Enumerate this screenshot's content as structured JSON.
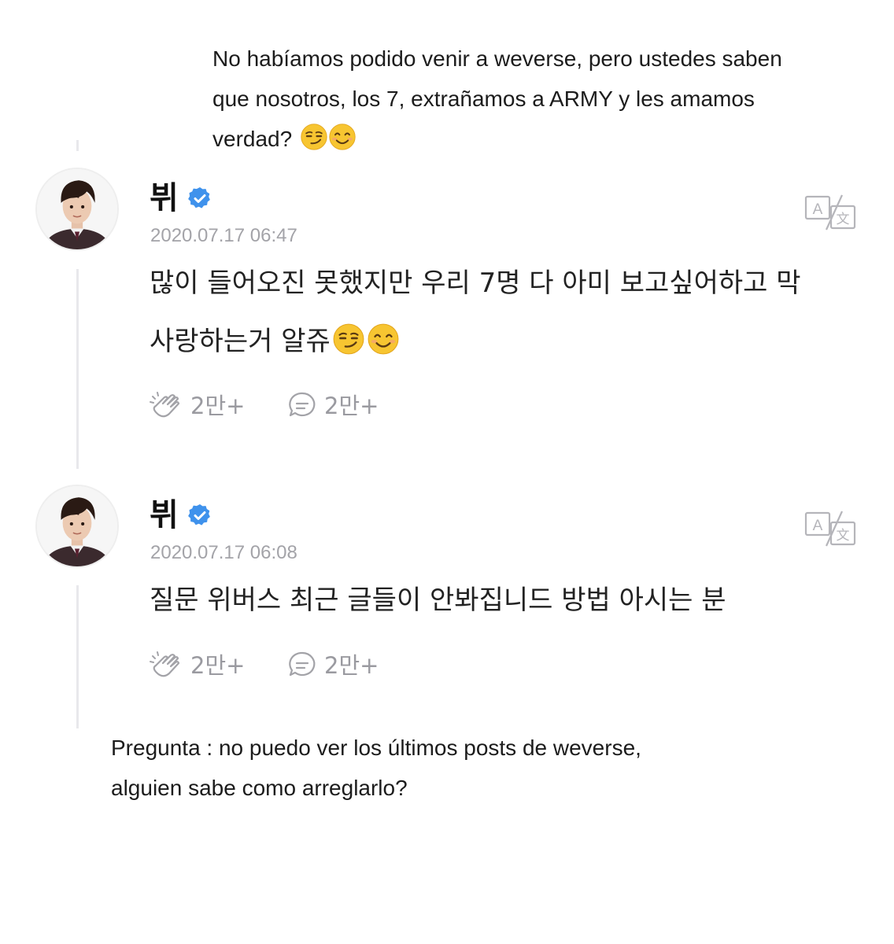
{
  "translations": {
    "top": [
      "No habíamos podido venir a weverse, pero ustedes saben",
      "que nosotros, los 7, extrañamos a ARMY y les amamos",
      "verdad?"
    ],
    "bottom": [
      "Pregunta : no puedo ver los últimos posts de weverse,",
      "alguien sabe como arreglarlo?"
    ]
  },
  "posts": [
    {
      "author": "뷔",
      "timestamp": "2020.07.17 06:47",
      "lines": [
        "많이 들어오진 못했지만 우리 7명 다 아미 보고싶어하고 막",
        "사랑하는거 알쥬"
      ],
      "likes": "2만+",
      "comments": "2만+"
    },
    {
      "author": "뷔",
      "timestamp": "2020.07.17 06:08",
      "lines": [
        "질문 위버스 최근 글들이 안봐집니드 방법 아시는 분"
      ],
      "likes": "2만+",
      "comments": "2만+"
    }
  ],
  "icons": {
    "verified": "verified-check-icon",
    "translate": "translate-icon",
    "like": "clap-icon",
    "comment": "comment-bubble-icon",
    "emoji_1": "smirking-face-emoji",
    "emoji_2": "smiling-face-emoji"
  },
  "colors": {
    "verified": "#3f92ec",
    "muted": "#a3a3a8",
    "thread_line": "#e8e8ec"
  }
}
